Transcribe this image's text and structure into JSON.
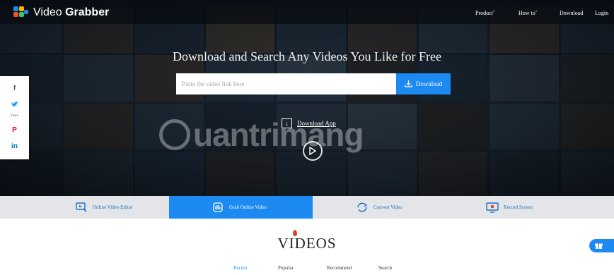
{
  "header": {
    "logo_text_light": "Video ",
    "logo_text_bold": "Grabber",
    "nav": [
      {
        "label": "Product",
        "has_dropdown": true
      },
      {
        "label": "How to",
        "has_dropdown": true
      },
      {
        "label": "Download",
        "has_dropdown": false
      },
      {
        "label": "Login",
        "has_dropdown": false
      }
    ]
  },
  "hero": {
    "headline": "Download and Search Any Videos You Like for Free",
    "search_placeholder": "Paste the video link here",
    "download_button": "Download",
    "download_app": "Download App",
    "watermark": "uantrimang"
  },
  "share": {
    "items": [
      {
        "icon": "facebook-icon",
        "glyph": "f"
      },
      {
        "icon": "twitter-icon",
        "glyph": "♥",
        "label": "Share"
      },
      {
        "icon": "pinterest-icon",
        "glyph": "P"
      },
      {
        "icon": "linkedin-icon",
        "glyph": "in"
      }
    ]
  },
  "features": [
    {
      "label": "Online Video Editor",
      "icon": "video-editor-icon",
      "active": false
    },
    {
      "label": "Grab Online Video",
      "icon": "grab-hand-icon",
      "active": true
    },
    {
      "label": "Convert Video",
      "icon": "convert-icon",
      "active": false
    },
    {
      "label": "Record Screen",
      "icon": "record-screen-icon",
      "active": false
    }
  ],
  "videos": {
    "title": "VIDEOS",
    "tabs": [
      {
        "label": "Recent",
        "active": true
      },
      {
        "label": "Popular",
        "active": false
      },
      {
        "label": "Recommend",
        "active": false
      },
      {
        "label": "Search",
        "active": false
      }
    ]
  },
  "colors": {
    "accent": "#1c8af0",
    "feature_bar": "#e3e5e8",
    "hero_dark": "#15212e",
    "facebook": "#3b5998",
    "twitter": "#1da1f2",
    "pinterest": "#e60023",
    "linkedin": "#0077b5"
  }
}
